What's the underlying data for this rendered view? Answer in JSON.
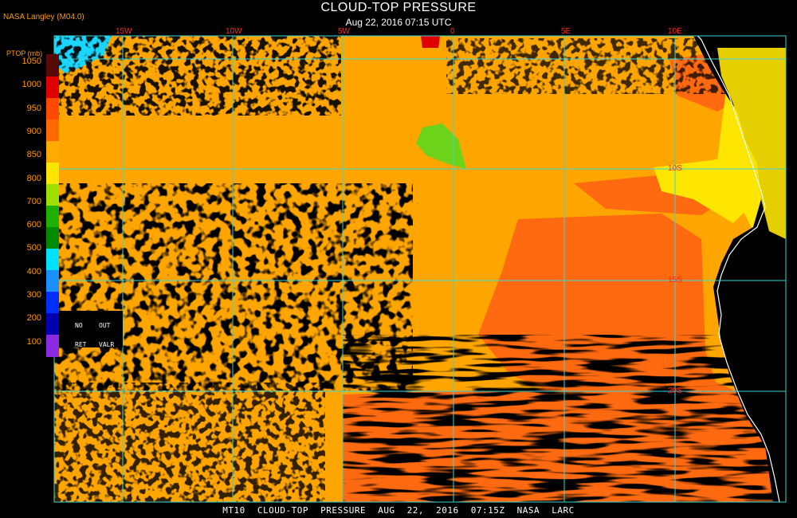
{
  "header": {
    "title": "CLOUD-TOP PRESSURE",
    "datetime": "Aug 22, 2016 07:15 UTC",
    "agency": "NASA Langley (M04.0)"
  },
  "footer": {
    "caption": "MT10 CLOUD-TOP PRESSURE AUG 22, 2016 07:15Z NASA LARC"
  },
  "legend": {
    "unit_label": "PTOP (mb)",
    "ticks": [
      "1050",
      "1000",
      "950",
      "900",
      "850",
      "800",
      "700",
      "600",
      "500",
      "400",
      "300",
      "200",
      "100"
    ],
    "colors": [
      "#5a0a06",
      "#e00000",
      "#ff4a00",
      "#ff6a00",
      "#ffaa00",
      "#ffe600",
      "#a0e000",
      "#20b000",
      "#008a00",
      "#00e0ff",
      "#1a90ff",
      "#0030ff",
      "#0000b0",
      "#8a2be2"
    ],
    "no_ret_top": "NO",
    "no_ret_bottom": "RET",
    "out_valr_top": "OUT",
    "out_valr_bottom": "VALR"
  },
  "map": {
    "longitude_labels": [
      "15W",
      "10W",
      "5W",
      "0",
      "5E",
      "10E"
    ],
    "latitude_labels": [
      "10S",
      "15S",
      "20S"
    ],
    "colors": {
      "ocean_cloud": "#ffa500",
      "low_cloud": "#ff6a10",
      "mid": "#ffe600",
      "green": "#6dd21a",
      "cyan": "#1ad6ff",
      "clear": "#000000",
      "grid": "#39d6d6",
      "coast": "#ffffff",
      "label": "#ff2a1a"
    }
  }
}
